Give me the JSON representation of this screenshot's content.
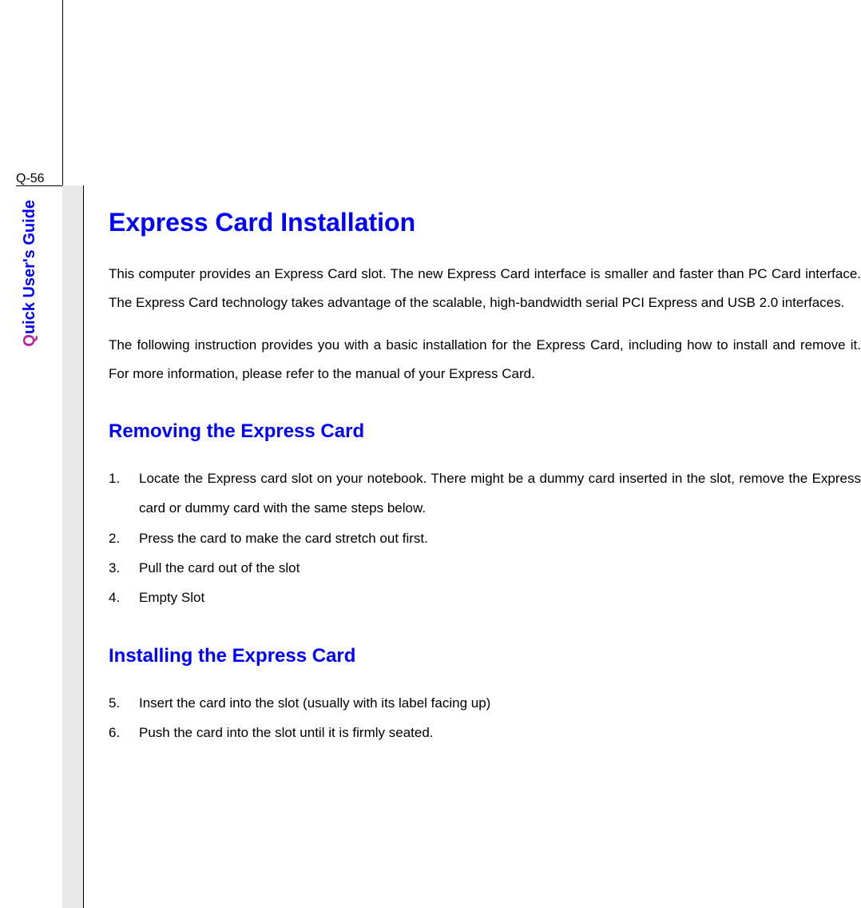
{
  "page_number": "Q-56",
  "sidebar": {
    "prefix": "Q",
    "text": "uick User's Guide"
  },
  "heading1": "Express Card Installation",
  "para1": "This computer provides an Express Card slot.  The new Express Card interface is smaller and faster than PC Card interface.  The Express Card technology takes advantage of the scalable, high-bandwidth serial PCI Express and USB 2.0 interfaces.",
  "para2": "The following instruction provides you with a basic installation for the Express Card, including how to install and remove it.   For more information, please refer to the manual of your Express Card.",
  "heading2a": "Removing the Express Card",
  "list1": [
    {
      "num": "1.",
      "text": "Locate the Express card slot on your notebook.   There might be a dummy card inserted in the slot, remove the Express card or dummy card with the same steps below."
    },
    {
      "num": "2.",
      "text": "Press the card to make the card stretch out first."
    },
    {
      "num": "3.",
      "text": "Pull the card out of the slot"
    },
    {
      "num": "4.",
      "text": "Empty Slot"
    }
  ],
  "heading2b": "Installing the Express Card",
  "list2": [
    {
      "num": "5.",
      "text": "Insert the card into the slot (usually with its label facing up)"
    },
    {
      "num": "6.",
      "text": "Push the card into the slot until it is firmly seated."
    }
  ]
}
